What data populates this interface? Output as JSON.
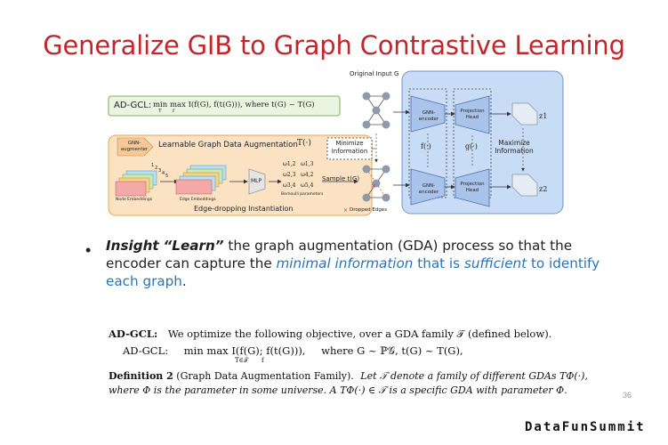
{
  "slide": {
    "title": "Generalize GIB to Graph Contrastive Learning",
    "page_number": "36",
    "brand": "DataFunSummit"
  },
  "diagram": {
    "objective_label": "AD-GCL:",
    "objective_formula": "min max I(f(G), f(t(G))), where t(G) ~ T(G)",
    "objective_min_sub": "T",
    "objective_max_sub": "f",
    "original_input": "Original Input G",
    "gnn_augmenter": "GNN-augmenter",
    "learnable_gda": "Learnable Graph Data Augmentation",
    "learnable_gda_symbol": "T(·)",
    "minimize_information": "Minimize Information",
    "node_embeddings": "Node Embeddings",
    "edge_embeddings": "Edge Embeddings",
    "mlp": "MLP",
    "omega_values": [
      "ω1,2",
      "ω1,3",
      "ω2,3",
      "ω4,2",
      "ω3,4",
      "ω5,4"
    ],
    "bernoulli_parameters": "Bernoulli parameters",
    "sample_label": "Sample t(G)",
    "edge_dropping": "Edge-dropping Instantiation",
    "dropped_edges": "Dropped Edges",
    "gnn_encoder_top": "GNN-encoder",
    "gnn_encoder_bottom": "GNN-encoder",
    "f_label": "f(·)",
    "projection_head_top": "Projection Head",
    "projection_head_bottom": "Projection Head",
    "g_label": "g(·)",
    "maximize_information": "Maximize Information",
    "z1": "z1",
    "z2": "z2",
    "node_numbers": [
      "1",
      "2",
      "3",
      "4",
      "5"
    ],
    "colors": {
      "objective_box": "#e9f5e1",
      "objective_border": "#7cb062",
      "augmentation_box": "#fbe2c2",
      "augmentation_border": "#e8a456",
      "encoder_panel": "#c9dcf5",
      "encoder_border": "#6e95cf",
      "node_fill": "#8e9aa6"
    }
  },
  "bullet": {
    "insight_label": "Insight",
    "learn_word": "“Learn”",
    "text_1": " the graph augmentation (GDA) process so that the encoder can capture the ",
    "minimal_information": "minimal information",
    "text_2": " that is ",
    "sufficient": "sufficient",
    "text_3": " to identify each graph",
    "period": "."
  },
  "paper": {
    "line1_label": "AD-GCL:",
    "line1_text": "We optimize the following objective, over a GDA family 𝒯 (defined below).",
    "line2_label": "AD-GCL:",
    "line2_formula": "min max I(f(G); f(t(G))),",
    "line2_min_sub": "T∈𝒯",
    "line2_max_sub": "f",
    "line2_where": "where G ~ ℙ𝒢, t(G) ~ T(G),",
    "def_label": "Definition 2",
    "def_title": "(Graph Data Augmentation Family).",
    "def_text_1": "Let 𝒯 denote a family of different GDAs TΦ(·),",
    "def_text_2": "where Φ is the parameter in some universe. A TΦ(·) ∈ 𝒯 is a specific GDA with parameter Φ."
  }
}
